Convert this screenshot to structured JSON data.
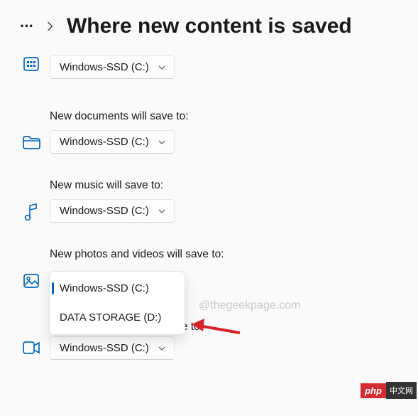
{
  "breadcrumb": {
    "dots": "···",
    "title": "Where new content is saved"
  },
  "sections": {
    "apps": {
      "selected": "Windows-SSD (C:)"
    },
    "documents": {
      "label": "New documents will save to:",
      "selected": "Windows-SSD (C:)"
    },
    "music": {
      "label": "New music will save to:",
      "selected": "Windows-SSD (C:)"
    },
    "photos": {
      "label": "New photos and videos will save to:",
      "options": [
        "Windows-SSD (C:)",
        "DATA STORAGE (D:)"
      ]
    },
    "movies": {
      "label": "will save to:",
      "selected": "Windows-SSD (C:)"
    }
  },
  "watermark": "@thegeekpage.com",
  "badge": {
    "left": "php",
    "right": "中文网"
  }
}
